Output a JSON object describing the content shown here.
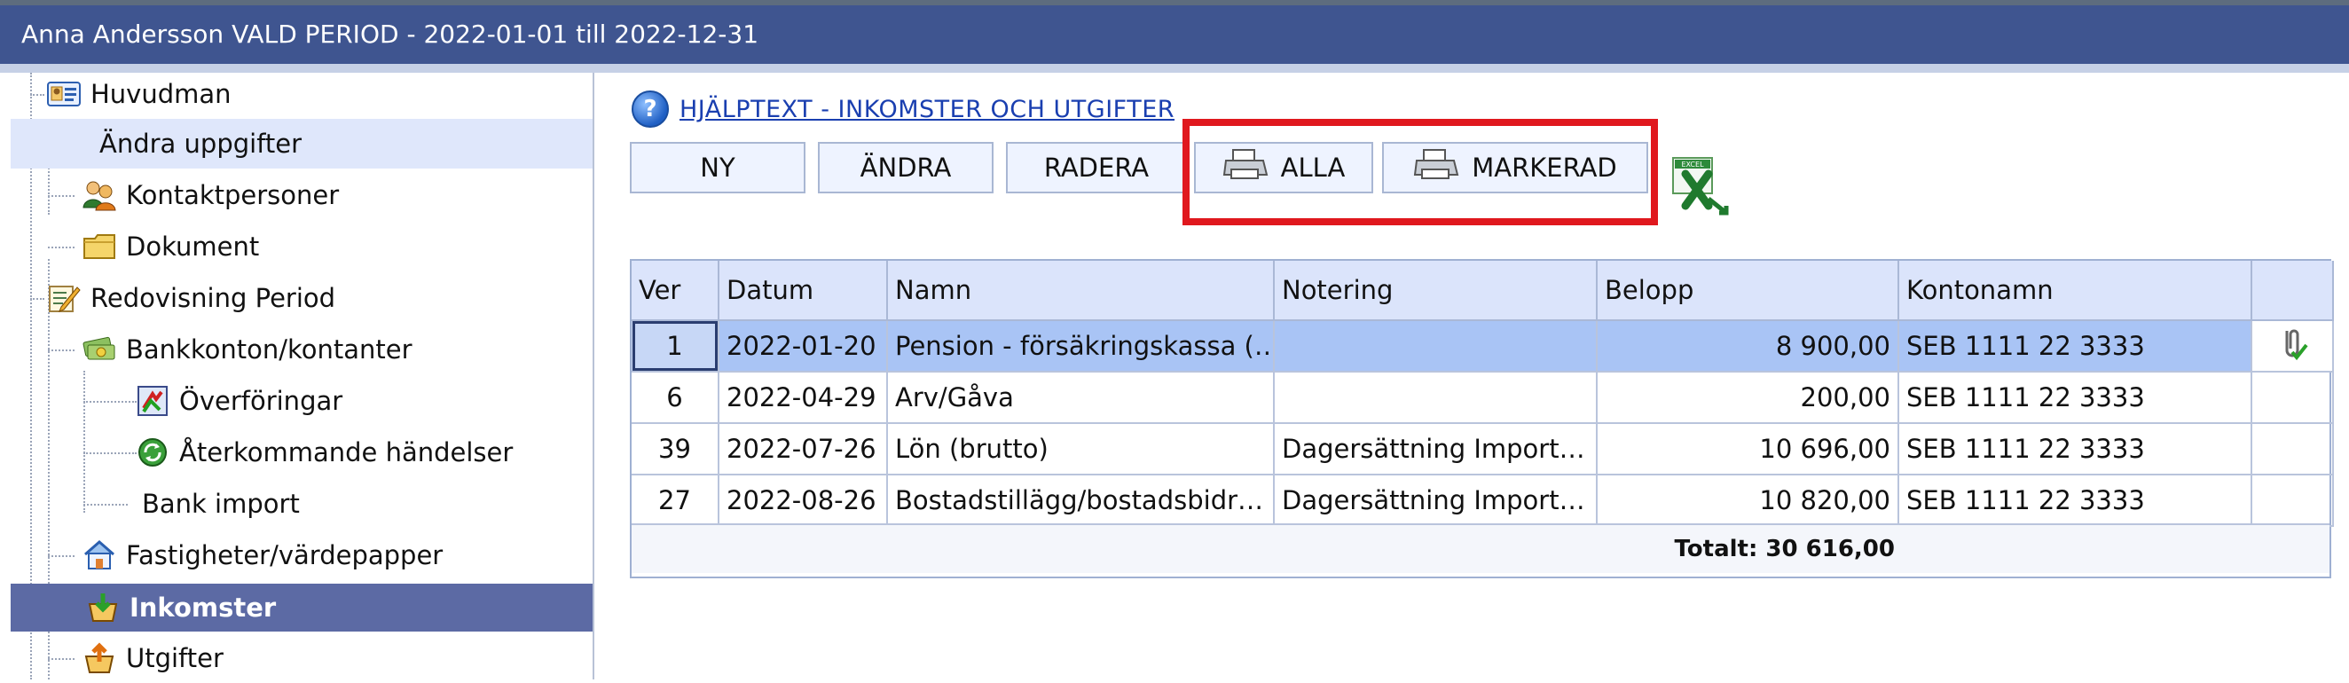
{
  "window": {
    "title": "Anna Andersson  VALD PERIOD - 2022-01-01 till 2022-12-31"
  },
  "sidebar": {
    "items": [
      {
        "label": "Huvudman",
        "icon": "id-card-icon"
      },
      {
        "label": "Ändra uppgifter",
        "icon": ""
      },
      {
        "label": "Kontaktpersoner",
        "icon": "contacts-icon"
      },
      {
        "label": "Dokument",
        "icon": "folder-icon"
      },
      {
        "label": "Redovisning Period",
        "icon": "report-pencil-icon"
      },
      {
        "label": "Bankkonton/kontanter",
        "icon": "money-icon"
      },
      {
        "label": "Överföringar",
        "icon": "transfer-icon"
      },
      {
        "label": "Återkommande händelser",
        "icon": "recycle-icon"
      },
      {
        "label": "Bank import",
        "icon": ""
      },
      {
        "label": "Fastigheter/värdepapper",
        "icon": "house-icon"
      },
      {
        "label": "Inkomster",
        "icon": "income-icon"
      },
      {
        "label": "Utgifter",
        "icon": "expense-icon"
      }
    ]
  },
  "help": {
    "link_text": "HJÄLPTEXT - INKOMSTER OCH UTGIFTER"
  },
  "toolbar": {
    "new_label": "NY",
    "edit_label": "ÄNDRA",
    "delete_label": "RADERA",
    "print_all_label": "ALLA",
    "print_selected_label": "MARKERAD",
    "excel_icon_text": "EXCEL"
  },
  "table": {
    "headers": [
      "Ver",
      "Datum",
      "Namn",
      "Notering",
      "Belopp",
      "Kontonamn",
      ""
    ],
    "rows": [
      {
        "ver": "1",
        "datum": "2022-01-20",
        "namn": "Pension - försäkringskassa (…",
        "notering": "",
        "belopp": "8 900,00",
        "konto": "SEB 1111 22 3333",
        "attachment": true
      },
      {
        "ver": "6",
        "datum": "2022-04-29",
        "namn": "Arv/Gåva",
        "notering": "",
        "belopp": "200,00",
        "konto": "SEB 1111 22 3333",
        "attachment": false
      },
      {
        "ver": "39",
        "datum": "2022-07-26",
        "namn": "Lön (brutto)",
        "notering": "Dagersättning  Import…",
        "belopp": "10 696,00",
        "konto": "SEB 1111 22 3333",
        "attachment": false
      },
      {
        "ver": "27",
        "datum": "2022-08-26",
        "namn": "Bostadstillägg/bostadsbidr…",
        "notering": "Dagersättning  Import…",
        "belopp": "10 820,00",
        "konto": "SEB 1111 22 3333",
        "attachment": false
      }
    ],
    "total": "Totalt: 30 616,00"
  },
  "colors": {
    "titlebar": "#3f5590",
    "selected_nav": "#5c6aa4",
    "selected_row": "#a9c4f5",
    "highlight": "#e0181e"
  }
}
